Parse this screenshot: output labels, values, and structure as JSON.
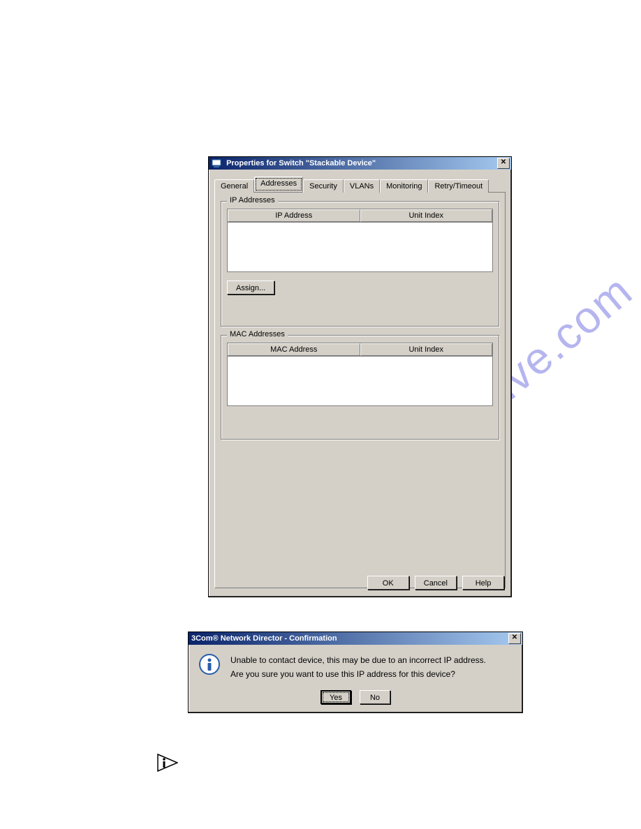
{
  "watermark": "manualshive.com",
  "properties_dialog": {
    "title": "Properties for Switch \"Stackable Device\"",
    "tabs": [
      "General",
      "Addresses",
      "Security",
      "VLANs",
      "Monitoring",
      "Retry/Timeout"
    ],
    "active_tab_index": 1,
    "ip_group": {
      "legend": "IP Addresses",
      "columns": [
        "IP Address",
        "Unit Index"
      ],
      "assign_button": "Assign..."
    },
    "mac_group": {
      "legend": "MAC Addresses",
      "columns": [
        "MAC Address",
        "Unit Index"
      ]
    },
    "footer": {
      "ok": "OK",
      "cancel": "Cancel",
      "help": "Help"
    }
  },
  "confirm_dialog": {
    "title": "3Com® Network Director - Confirmation",
    "line1": "Unable to contact device, this may be due to an incorrect IP address.",
    "line2": "Are you sure you want to use this IP address for this device?",
    "yes": "Yes",
    "no": "No"
  }
}
